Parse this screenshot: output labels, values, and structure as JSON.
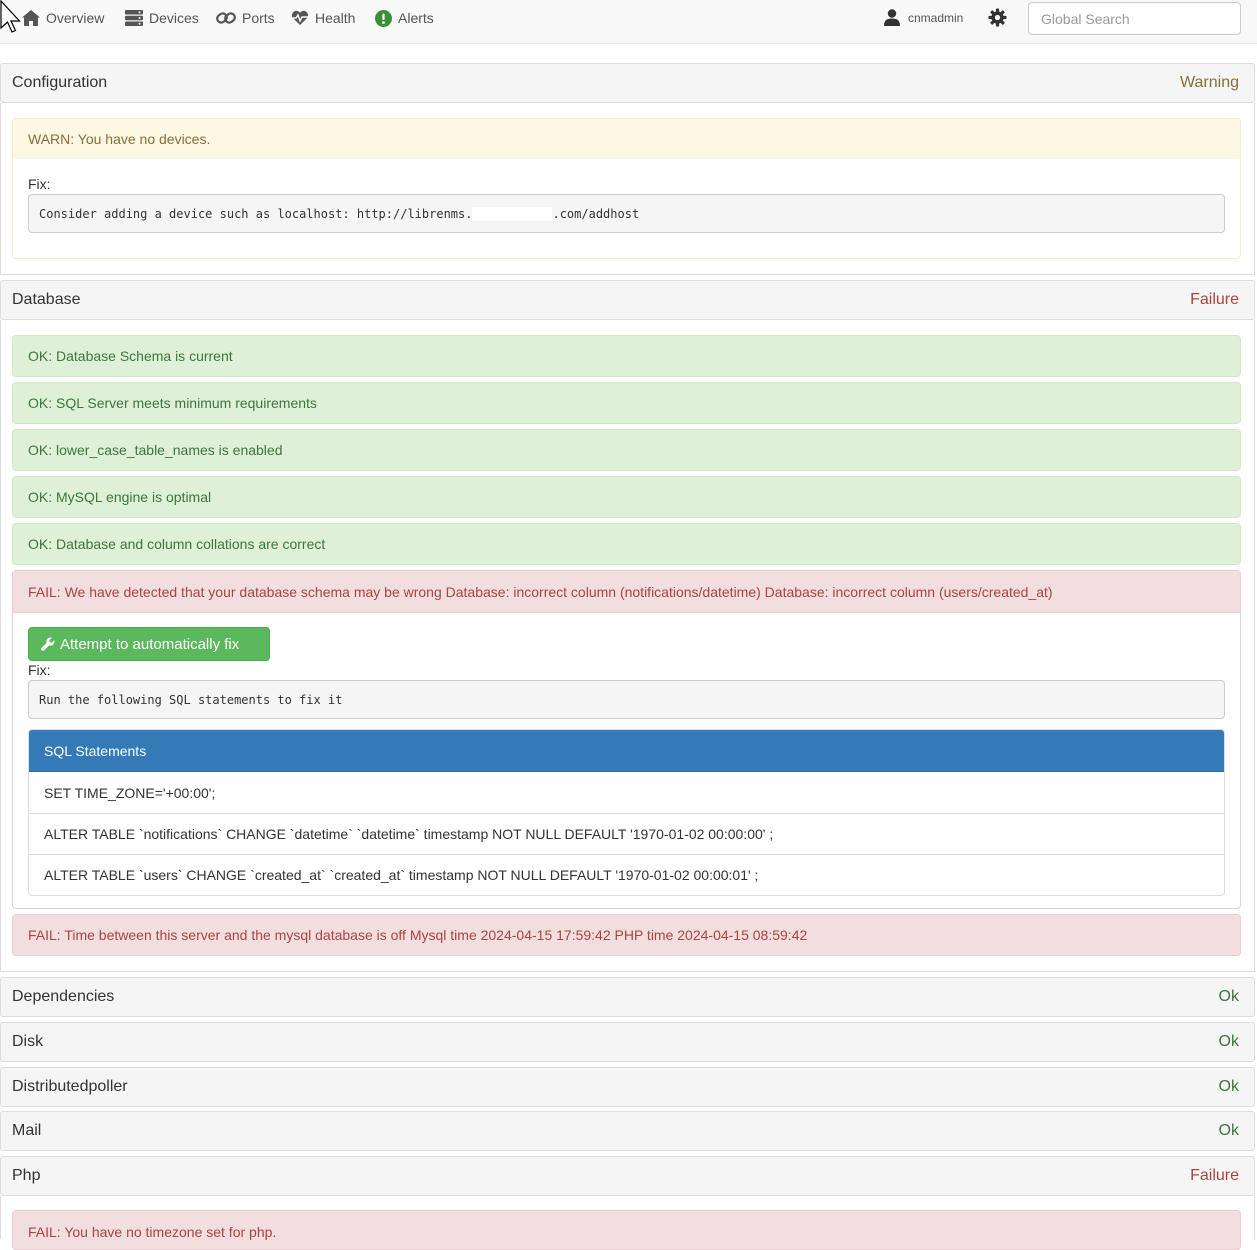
{
  "navbar": {
    "items": [
      {
        "label": "Overview",
        "icon": "home-icon"
      },
      {
        "label": "Devices",
        "icon": "server-icon"
      },
      {
        "label": "Ports",
        "icon": "link-icon"
      },
      {
        "label": "Health",
        "icon": "heartbeat-icon"
      },
      {
        "label": "Alerts",
        "icon": "alert-circle-icon"
      }
    ],
    "user": "cnmadmin",
    "search_placeholder": "Global Search"
  },
  "sections": {
    "configuration": {
      "title": "Configuration",
      "status": "Warning",
      "warn_text": "WARN: You have no devices.",
      "fix_label": "Fix:",
      "fix_prefix": "Consider adding a device such as localhost: http://librenms.",
      "fix_suffix": ".com/addhost"
    },
    "database": {
      "title": "Database",
      "status": "Failure",
      "ok_items": [
        "OK: Database Schema is current",
        "OK: SQL Server meets minimum requirements",
        "OK: lower_case_table_names is enabled",
        "OK: MySQL engine is optimal",
        "OK: Database and column collations are correct"
      ],
      "schema_fail": "FAIL: We have detected that your database schema may be wrong Database: incorrect column (notifications/datetime) Database: incorrect column (users/created_at)",
      "fix_button": "Attempt to automatically fix",
      "fix_label": "Fix:",
      "fix_text": "Run the following SQL statements to fix it",
      "sql_title": "SQL Statements",
      "sql_statements": [
        "SET TIME_ZONE='+00:00';",
        "ALTER TABLE `notifications` CHANGE `datetime` `datetime` timestamp NOT NULL DEFAULT '1970-01-02 00:00:00' ;",
        "ALTER TABLE `users` CHANGE `created_at` `created_at` timestamp NOT NULL DEFAULT '1970-01-02 00:00:01' ;"
      ],
      "time_fail": "FAIL: Time between this server and the mysql database is off Mysql time 2024-04-15 17:59:42 PHP time 2024-04-15 08:59:42"
    },
    "dependencies": {
      "title": "Dependencies",
      "status": "Ok"
    },
    "disk": {
      "title": "Disk",
      "status": "Ok"
    },
    "distributedpoller": {
      "title": "Distributedpoller",
      "status": "Ok"
    },
    "mail": {
      "title": "Mail",
      "status": "Ok"
    },
    "php": {
      "title": "Php",
      "status": "Failure",
      "fail_text": "FAIL: You have no timezone set for php."
    }
  },
  "colors": {
    "ok": "#3c763d",
    "warning": "#8a6d3b",
    "failure": "#a94442",
    "primary": "#337ab7",
    "success_button": "#5cb85c"
  }
}
